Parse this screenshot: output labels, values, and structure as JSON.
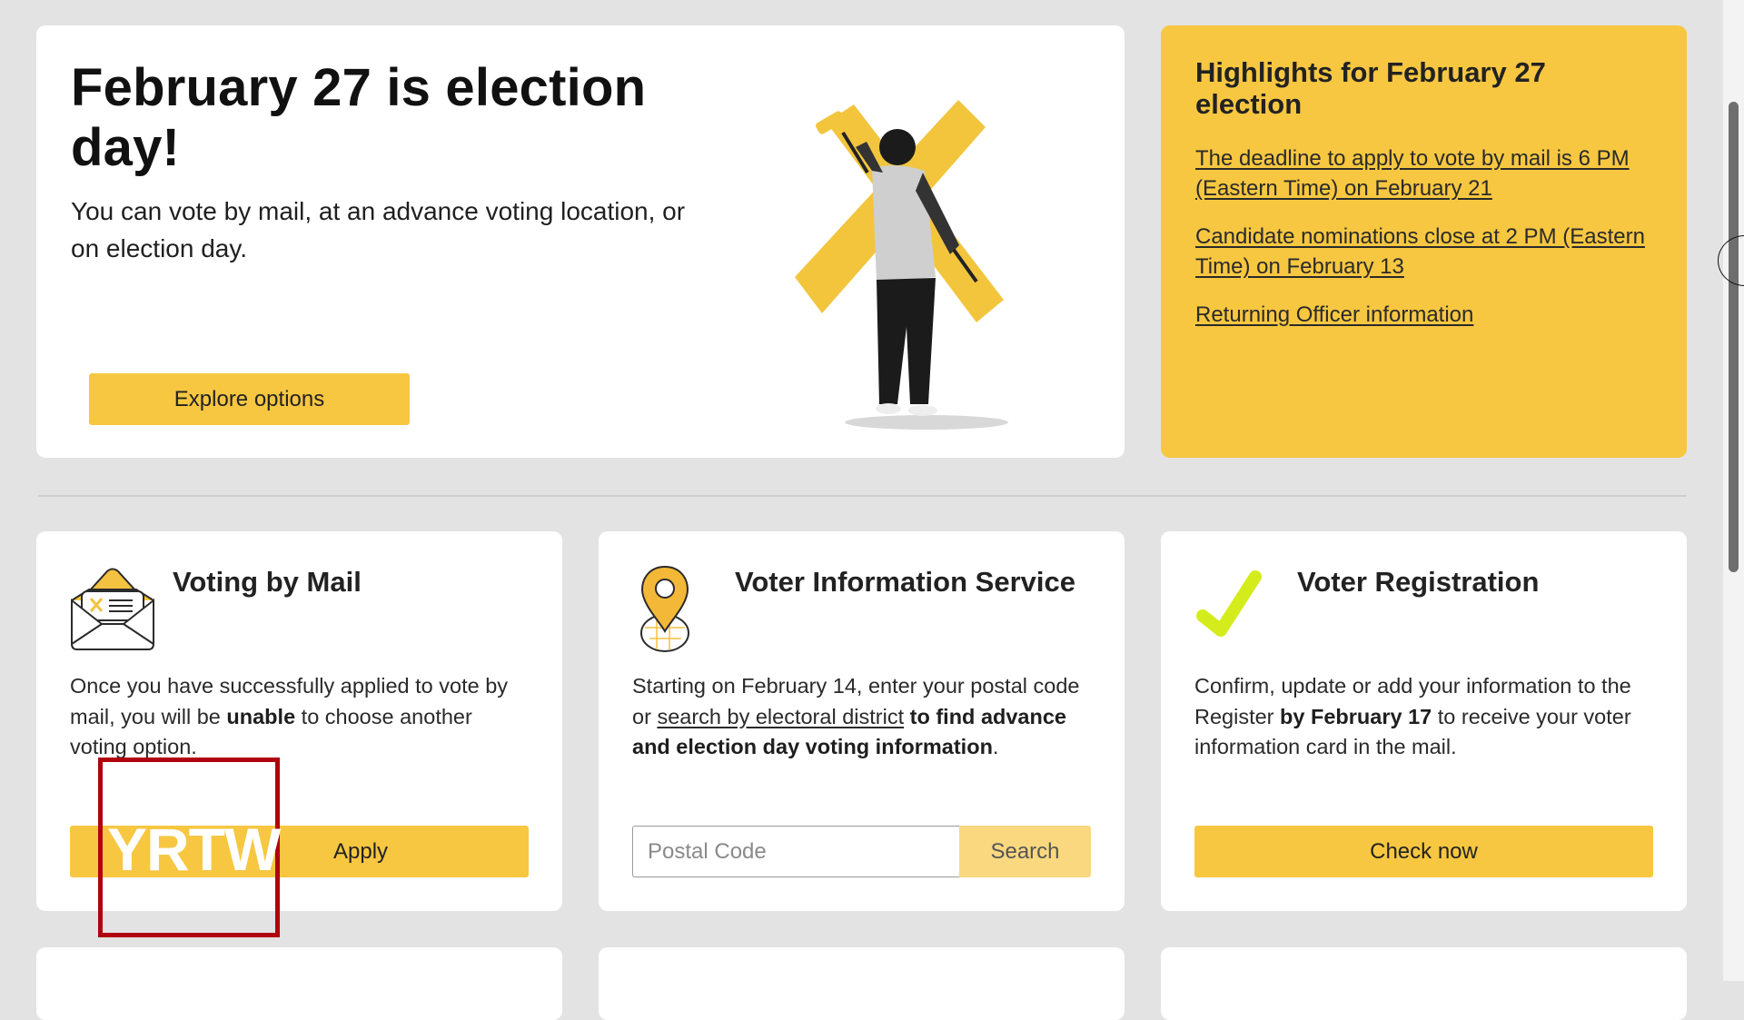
{
  "hero": {
    "title": "February 27 is election day!",
    "subtitle": "You can vote by mail, at an advance voting location, or on election day.",
    "button_label": "Explore options",
    "illustration": "person-painting-yellow-x"
  },
  "highlights": {
    "title": "Highlights for February 27 election",
    "links": [
      {
        "label": "The deadline to apply to vote by mail is 6 PM (Eastern Time) on February 21"
      },
      {
        "label": "Candidate nominations close at 2 PM (Eastern Time) on February 13"
      },
      {
        "label": "Returning Officer information"
      }
    ]
  },
  "tiles": [
    {
      "icon": "envelope-ballot-icon",
      "title": "Voting by Mail",
      "desc_pre": "Once you have successfully applied to vote by mail, you will be ",
      "desc_bold": "unable",
      "desc_post": " to choose another voting option.",
      "button_label": "Apply"
    },
    {
      "icon": "map-pin-icon",
      "title": "Voter Information Service",
      "desc_pre": "Starting on February 14, enter your postal code or ",
      "desc_link": "search by electoral district",
      "desc_bold": " to find advance and election day voting information",
      "desc_post": ".",
      "input_placeholder": "Postal Code",
      "input_value": "",
      "search_label": "Search"
    },
    {
      "icon": "checkmark-icon",
      "title": "Voter Registration",
      "desc_pre": "Confirm, update or add your information to the Register ",
      "desc_bold": "by February 17",
      "desc_post": " to receive your voter information card in the mail.",
      "button_label": "Check now"
    }
  ],
  "annotation": {
    "label": "YRTW"
  },
  "colors": {
    "accent_yellow": "#f7c741",
    "search_button_yellow": "#f9d880",
    "checkmark_green": "#d4ec1c",
    "page_background": "#e3e3e3",
    "annotation_red": "#b0000f"
  }
}
